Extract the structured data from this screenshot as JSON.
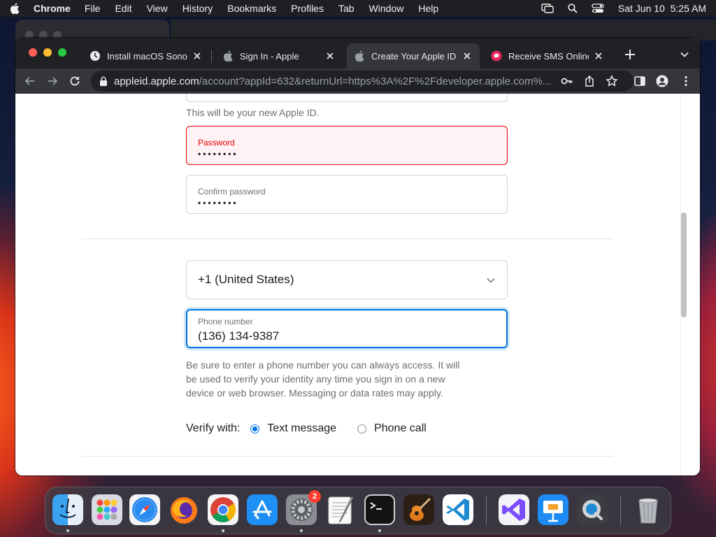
{
  "menubar": {
    "app_name": "Chrome",
    "items": [
      "File",
      "Edit",
      "View",
      "History",
      "Bookmarks",
      "Profiles",
      "Tab",
      "Window",
      "Help"
    ],
    "datetime": "Sat Jun 10  5:25 AM"
  },
  "tabs": [
    {
      "title": "Install macOS Sonoma",
      "icon": "clock-icon"
    },
    {
      "title": "Sign In - Apple",
      "icon": "apple-icon"
    },
    {
      "title": "Create Your Apple ID -",
      "icon": "apple-icon",
      "active": true
    },
    {
      "title": "Receive SMS Online Fo",
      "icon": "sms-icon"
    }
  ],
  "address": {
    "host": "appleid.apple.com",
    "path": "/account?appId=632&returnUrl=https%3A%2F%2Fdeveloper.apple.com%..."
  },
  "form": {
    "apple_id_hint": "This will be your new Apple ID.",
    "password": {
      "label": "Password",
      "value": "••••••••"
    },
    "confirm_password": {
      "label": "Confirm password",
      "value": "••••••••"
    },
    "country_code": "+1 (United States)",
    "phone": {
      "label": "Phone number",
      "value": "(136) 134-9387"
    },
    "phone_help": [
      "Be sure to enter a phone number you can always access. It will",
      "be used to verify your identity any time you sign in on a new",
      "device or web browser. Messaging or data rates may apply."
    ],
    "verify_label": "Verify with:",
    "verify_options": [
      {
        "label": "Text message",
        "selected": true
      },
      {
        "label": "Phone call",
        "selected": false
      }
    ]
  },
  "dock": {
    "apps": [
      "finder-icon",
      "launchpad-icon",
      "safari-icon",
      "firefox-icon",
      "chrome-icon",
      "app-store-icon",
      "system-settings-icon",
      "textedit-icon",
      "terminal-icon",
      "garageband-icon",
      "vscode-icon",
      "visual-studio-icon",
      "keynote-icon",
      "quicktime-icon",
      "trash-icon"
    ],
    "settings_badge": "2"
  },
  "colors": {
    "accent": "#0071e3",
    "error": "#e30000",
    "error_bg": "#fff2f4"
  }
}
